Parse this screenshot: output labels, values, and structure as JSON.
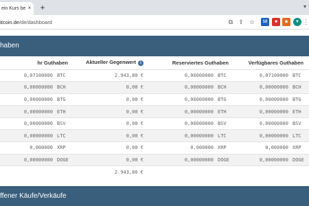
{
  "browser": {
    "tab_title": "ein Kurs be",
    "tab_close": "×",
    "new_tab": "+",
    "url_host": "itcoin.de",
    "url_path": "/de/dashboard"
  },
  "page": {
    "section_title": "haben",
    "bottom_section_title": "ffener Käufe/Verkäufe"
  },
  "balances": {
    "headers": {
      "own": "hr Guthaben",
      "value": "Aktueller Gegenwert",
      "reserved": "Reserviertes Guthaben",
      "available": "Verfügbares Guthaben"
    },
    "rows": [
      {
        "own": "0,07100000",
        "own_cur": "BTC",
        "value": "2.943,80 €",
        "reserved": "0,00000000",
        "reserved_cur": "BTC",
        "available": "0,07100000",
        "available_cur": "BTC"
      },
      {
        "own": "0,00000000",
        "own_cur": "BCH",
        "value": "0,00 €",
        "reserved": "0,00000000",
        "reserved_cur": "BCH",
        "available": "0,00000000",
        "available_cur": "BCH"
      },
      {
        "own": "0,00000000",
        "own_cur": "BTG",
        "value": "0,00 €",
        "reserved": "0,00000000",
        "reserved_cur": "BTG",
        "available": "0,00000000",
        "available_cur": "BTG"
      },
      {
        "own": "0,00000000",
        "own_cur": "ETH",
        "value": "0,00 €",
        "reserved": "0,00000000",
        "reserved_cur": "ETH",
        "available": "0,00000000",
        "available_cur": "ETH"
      },
      {
        "own": "0,00000000",
        "own_cur": "BSV",
        "value": "0,00 €",
        "reserved": "0,00000000",
        "reserved_cur": "BSV",
        "available": "0,00000000",
        "available_cur": "BSV"
      },
      {
        "own": "0,00000000",
        "own_cur": "LTC",
        "value": "0,00 €",
        "reserved": "0,00000000",
        "reserved_cur": "LTC",
        "available": "0,00000000",
        "available_cur": "LTC"
      },
      {
        "own": "0,000000",
        "own_cur": "XRP",
        "value": "0,00 €",
        "reserved": "0,000000",
        "reserved_cur": "XRP",
        "available": "0,000000",
        "available_cur": "XRP"
      },
      {
        "own": "0,00000000",
        "own_cur": "DOGE",
        "value": "0,00 €",
        "reserved": "0,00000000",
        "reserved_cur": "DOGE",
        "available": "0,00000000",
        "available_cur": "DOGE"
      }
    ],
    "total_value": "2.943,80 €"
  },
  "colors": {
    "header_bar": "#3a5f7d",
    "info_icon": "#3a6ea5",
    "row_stripe": "#f2f2f2"
  },
  "icons": [
    "close-icon",
    "plus-icon",
    "caret-down-icon",
    "share-icon",
    "bookmark-star-icon",
    "info-icon",
    "extension-icons"
  ]
}
